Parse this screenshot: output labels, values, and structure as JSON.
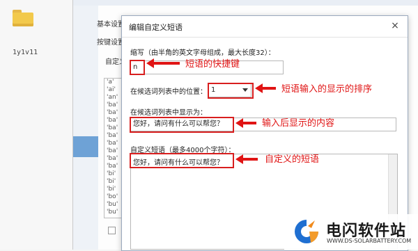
{
  "desktop": {
    "icon_label": "1y1v11"
  },
  "bg_window": {
    "menu_items": [
      "基本设置",
      "按键设置",
      "自定义短语"
    ],
    "list_rows": [
      "'a'",
      "'ai'",
      "'an'",
      "'ba'",
      "'ba'",
      "'ba'",
      "'ba'",
      "'ba'",
      "'ba'",
      "'ba'",
      "'ba'",
      "'ba'",
      "'bi'",
      "'bi'",
      "'bi'",
      "'bo'",
      "'bu'",
      "'bu'"
    ]
  },
  "dialog": {
    "title": "编辑自定义短语",
    "abbr_label": "缩写（由半角的英文字母组成，最大长度32）：",
    "abbr_value": "n",
    "position_label": "在候选词列表中的位置：",
    "position_value": "1",
    "display_label": "在候选词列表中显示为：",
    "display_value": "您好，请问有什么可以帮您？",
    "phrase_label": "自定义短语（最多4000个字符）：",
    "phrase_value": "您好，请问有什么可以帮您？"
  },
  "annotations": {
    "shortcut": "短语的快捷键",
    "order": "短语输入的显示的排序",
    "display": "输入后显示的内容",
    "phrase": "自定义的短语"
  },
  "watermark": {
    "title": "电闪软件站",
    "url": "WWW.DS-SOLARBATTERY.COM"
  },
  "colors": {
    "annotation_red": "#e01414",
    "selection_blue": "#6ea2d6"
  }
}
